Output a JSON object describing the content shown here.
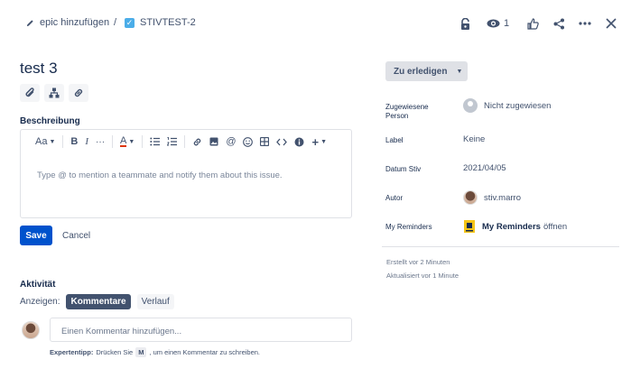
{
  "header": {
    "epic_label": "epic hinzufügen",
    "separator": "/",
    "issue_key": "STIVTEST-2",
    "watch_count": "1"
  },
  "issue": {
    "title": "test 3"
  },
  "description": {
    "label": "Beschreibung",
    "placeholder": "Type @ to mention a teammate and notify them about this issue.",
    "toolbar": {
      "text_style": "Aa",
      "bold": "B",
      "italic": "I",
      "more": "···",
      "color": "A"
    },
    "save_label": "Save",
    "cancel_label": "Cancel"
  },
  "activity": {
    "label": "Aktivität",
    "show_label": "Anzeigen:",
    "tab_comments": "Kommentare",
    "tab_history": "Verlauf",
    "comment_placeholder": "Einen Kommentar hinzufügen...",
    "tip_bold": "Expertentipp:",
    "tip_pre": "Drücken Sie",
    "tip_key": "M",
    "tip_post": ", um einen Kommentar zu schreiben."
  },
  "details": {
    "status": "Zu erledigen",
    "assignee_label": "Zugewiesene Person",
    "assignee_value": "Nicht zugewiesen",
    "label_label": "Label",
    "label_value": "Keine",
    "date_label": "Datum Stiv",
    "date_value": "2021/04/05",
    "author_label": "Autor",
    "author_value": "stiv.marro",
    "reminders_label": "My Reminders",
    "reminders_bold": "My Reminders",
    "reminders_rest": "öffnen",
    "created": "Erstellt vor 2 Minuten",
    "updated": "Aktualisiert vor 1 Minute"
  },
  "colors": {
    "primary": "#0052cc",
    "text": "#172b4d",
    "subtle": "#42526e",
    "task_icon": "#4bade8"
  }
}
